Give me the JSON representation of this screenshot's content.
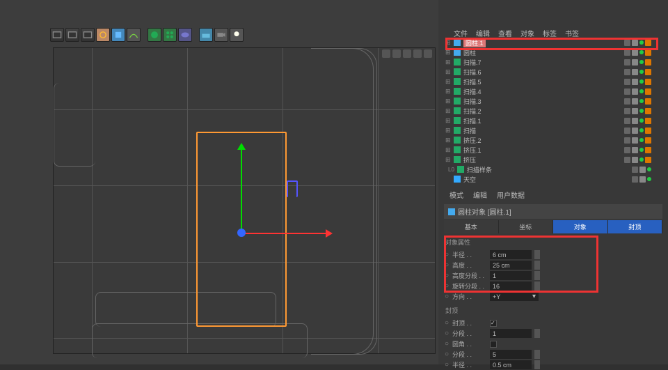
{
  "top_menu": {
    "items": [
      "文件",
      "编辑",
      "查看",
      "对象",
      "标签",
      "书签"
    ]
  },
  "objects": [
    {
      "name": "圆柱.1",
      "type": "cyl",
      "selected": true
    },
    {
      "name": "圆柱",
      "type": "cyl"
    },
    {
      "name": "扫描.7",
      "type": "sweep"
    },
    {
      "name": "扫描.6",
      "type": "sweep"
    },
    {
      "name": "扫描.5",
      "type": "sweep"
    },
    {
      "name": "扫描.4",
      "type": "sweep"
    },
    {
      "name": "扫描.3",
      "type": "sweep"
    },
    {
      "name": "扫描.2",
      "type": "sweep"
    },
    {
      "name": "扫描.1",
      "type": "sweep"
    },
    {
      "name": "扫描",
      "type": "sweep"
    },
    {
      "name": "挤压.2",
      "type": "ext"
    },
    {
      "name": "挤压.1",
      "type": "ext"
    },
    {
      "name": "挤压",
      "type": "ext"
    },
    {
      "name": "扫描样条",
      "type": "sweep",
      "prefix": "L0"
    },
    {
      "name": "天空",
      "type": "sky"
    }
  ],
  "attr_menu": {
    "items": [
      "模式",
      "编辑",
      "用户数据"
    ]
  },
  "attribute": {
    "title": "圆柱对象 [圆柱.1]",
    "tabs": [
      "基本",
      "坐标",
      "对象",
      "封顶"
    ],
    "section1": "对象属性",
    "section2": "封顶",
    "props": [
      {
        "label": "半径",
        "value": "6 cm",
        "type": "num"
      },
      {
        "label": "高度",
        "value": "25 cm",
        "type": "num"
      },
      {
        "label": "高度分段",
        "value": "1",
        "type": "num"
      },
      {
        "label": "旋转分段",
        "value": "16",
        "type": "num"
      },
      {
        "label": "方向",
        "value": "+Y",
        "type": "drop"
      }
    ],
    "caps": [
      {
        "label": "封顶",
        "type": "check",
        "checked": true
      },
      {
        "label": "分段",
        "value": "1",
        "type": "num"
      },
      {
        "label": "圆角",
        "type": "check",
        "checked": false
      },
      {
        "label": "分段",
        "value": "5",
        "type": "num"
      },
      {
        "label": "半径",
        "value": "0.5 cm",
        "type": "num"
      }
    ]
  }
}
